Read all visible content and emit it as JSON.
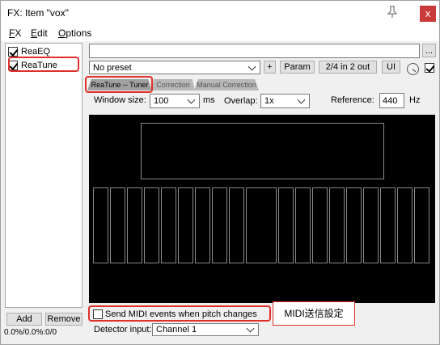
{
  "window": {
    "title": "FX: Item \"vox\"",
    "close_glyph": "x"
  },
  "menu": [
    "FX",
    "Edit",
    "Options"
  ],
  "fx_list": [
    {
      "name": "ReaEQ",
      "checked": true
    },
    {
      "name": "ReaTune",
      "checked": true
    }
  ],
  "sidebar_buttons": {
    "add": "Add",
    "remove": "Remove"
  },
  "status": "0.0%/0.0%:0/0",
  "toolbar": {
    "more": "...",
    "preset": "No preset",
    "plus": "+",
    "param": "Param",
    "io": "2/4 in 2 out",
    "ui": "UI"
  },
  "tabs": [
    "ReaTune -- Tuner",
    "Correction",
    "Manual Correction"
  ],
  "settings": {
    "window_size_label": "Window size:",
    "window_size_value": "100",
    "ms": "ms",
    "overlap_label": "Overlap:",
    "overlap_value": "1x",
    "reference_label": "Reference:",
    "reference_value": "440",
    "hz": "Hz"
  },
  "midi": {
    "label": "Send MIDI events when pitch changes",
    "checked": false
  },
  "detector": {
    "label": "Detector input:",
    "value": "Channel 1"
  },
  "callout": "MIDI送信設定",
  "colors": {
    "highlight": "#e0302a",
    "close": "#c93a3a",
    "tuner_bg": "#000000"
  }
}
